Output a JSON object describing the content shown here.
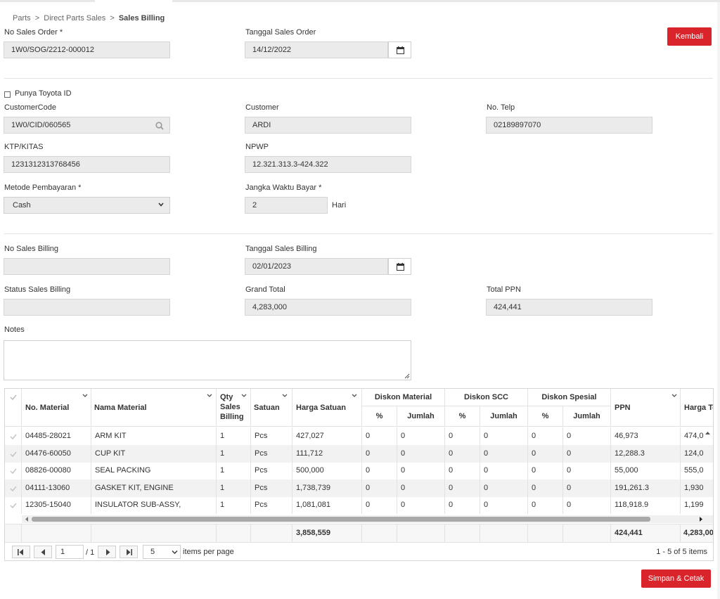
{
  "breadcrumb": {
    "items": [
      "Parts",
      "Direct Parts Sales"
    ],
    "current": "Sales Billing",
    "sep": ">"
  },
  "header": {
    "no_sales_order_label": "No Sales Order *",
    "no_sales_order_value": "1W0/SOG/2212-000012",
    "tanggal_sales_order_label": "Tanggal Sales Order",
    "tanggal_sales_order_value": "14/12/2022",
    "kembali_label": "Kembali"
  },
  "customer": {
    "toyota_id_label": "Punya Toyota ID",
    "customer_code_label": "CustomerCode",
    "customer_code_value": "1W0/CID/060565",
    "customer_label": "Customer",
    "customer_value": "ARDI",
    "telp_label": "No. Telp",
    "telp_value": "02189897070",
    "ktp_label": "KTP/KITAS",
    "ktp_value": "1231312313768456",
    "npwp_label": "NPWP",
    "npwp_value": "12.321.313.3-424.322",
    "metode_label": "Metode Pembayaran *",
    "metode_value": "Cash",
    "jangka_label": "Jangka Waktu Bayar *",
    "jangka_value": "2",
    "hari_label": "Hari"
  },
  "billing": {
    "no_sales_billing_label": "No Sales Billing",
    "no_sales_billing_value": "",
    "tanggal_sales_billing_label": "Tanggal Sales Billing",
    "tanggal_sales_billing_value": "02/01/2023",
    "status_label": "Status Sales Billing",
    "status_value": "",
    "grand_total_label": "Grand Total",
    "grand_total_value": "4,283,000",
    "total_ppn_label": "Total PPN",
    "total_ppn_value": "424,441",
    "notes_label": "Notes"
  },
  "grid": {
    "headers": {
      "no_material": "No. Material",
      "nama_material": "Nama Material",
      "qty_1": "Qty",
      "qty_2": "Sales",
      "qty_3": "Billing",
      "satuan": "Satuan",
      "harga_satuan": "Harga Satuan",
      "diskon_material": "Diskon Material",
      "diskon_scc": "Diskon SCC",
      "diskon_spesial": "Diskon Spesial",
      "pct": "%",
      "jumlah": "Jumlah",
      "ppn": "PPN",
      "harga_total": "Harga To"
    },
    "rows": [
      [
        "04485-28021",
        "ARM KIT",
        "1",
        "Pcs",
        "427,027",
        "0",
        "0",
        "0",
        "0",
        "0",
        "0",
        "46,973",
        "474,0"
      ],
      [
        "04476-60050",
        "CUP KIT",
        "1",
        "Pcs",
        "111,712",
        "0",
        "0",
        "0",
        "0",
        "0",
        "0",
        "12,288.3",
        "124,0"
      ],
      [
        "08826-00080",
        "SEAL PACKING",
        "1",
        "Pcs",
        "500,000",
        "0",
        "0",
        "0",
        "0",
        "0",
        "0",
        "55,000",
        "555,0"
      ],
      [
        "04111-13060",
        "GASKET KIT, ENGINE",
        "1",
        "Pcs",
        "1,738,739",
        "0",
        "0",
        "0",
        "0",
        "0",
        "0",
        "191,261.3",
        "1,930"
      ],
      [
        "12305-15040",
        "INSULATOR SUB-ASSY,",
        "1",
        "Pcs",
        "1,081,081",
        "0",
        "0",
        "0",
        "0",
        "0",
        "0",
        "118,918.9",
        "1,199"
      ]
    ],
    "footer": {
      "harga_satuan_total": "3,858,559",
      "ppn_total": "424,441",
      "harga_total": "4,283,00"
    },
    "pager": {
      "page": "1",
      "of": "/ 1",
      "page_size": "5",
      "items_per_page": "items per page",
      "summary": "1 - 5 of 5 items"
    }
  },
  "actions": {
    "simpan_label": "Simpan & Cetak"
  },
  "colors": {
    "accent_red": "#d9242b",
    "field_bg": "#ebebeb"
  }
}
